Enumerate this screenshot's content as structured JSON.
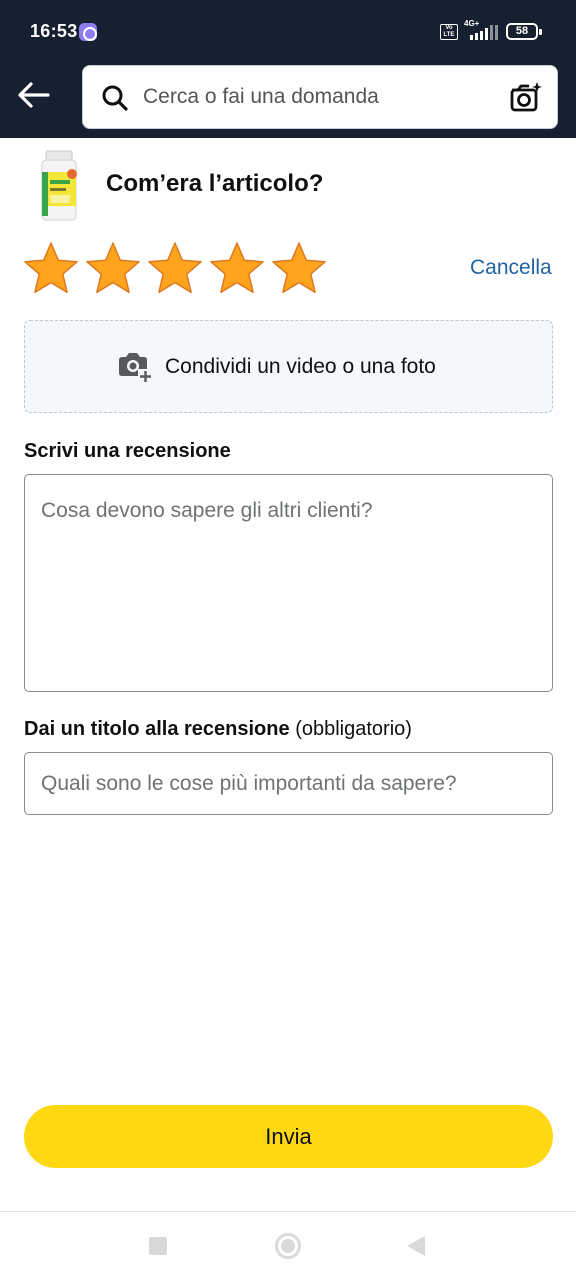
{
  "status_bar": {
    "time": "16:53",
    "network": "4G+",
    "volte": "Vo LTE",
    "battery": "58"
  },
  "header": {
    "search_placeholder": "Cerca o fai una domanda"
  },
  "product": {
    "question": "Com’era l’articolo?"
  },
  "rating": {
    "value": 5,
    "max": 5,
    "star_color": "#ffa41c",
    "cancel_label": "Cancella"
  },
  "media": {
    "label": "Condividi un video o una foto"
  },
  "review": {
    "label": "Scrivi una recensione",
    "placeholder": "Cosa devono sapere gli altri clienti?"
  },
  "title": {
    "label": "Dai un titolo alla recensione",
    "optional_note": "(obbligatorio)",
    "placeholder": "Quali sono le cose più importanti da sapere?"
  },
  "submit": {
    "label": "Invia",
    "color": "#ffd814"
  },
  "colors": {
    "header_bg": "#172030",
    "link": "#2162a1"
  }
}
